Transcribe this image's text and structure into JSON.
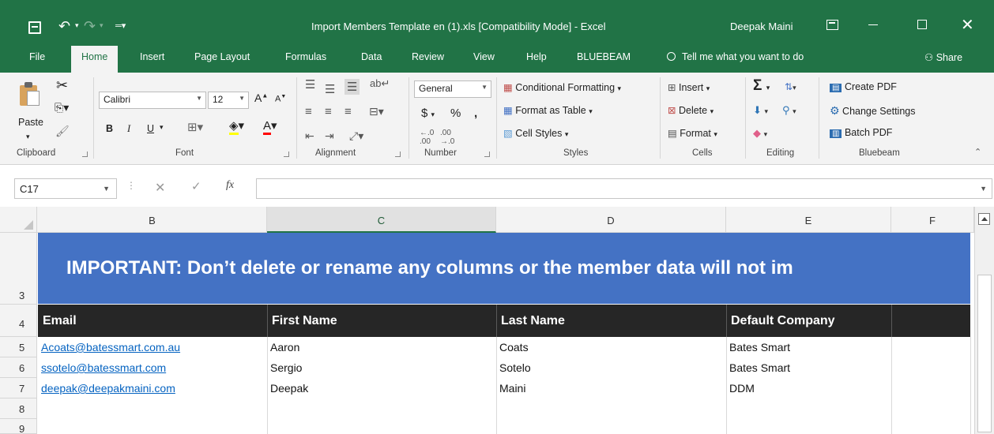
{
  "window": {
    "title": "Import Members Template en (1).xls  [Compatibility Mode]  -  Excel",
    "user": "Deepak Maini"
  },
  "tabs": [
    "File",
    "Home",
    "Insert",
    "Page Layout",
    "Formulas",
    "Data",
    "Review",
    "View",
    "Help",
    "BLUEBEAM"
  ],
  "active_tab": "Home",
  "tell_me": "Tell me what you want to do",
  "share": "Share",
  "ribbon": {
    "clipboard": {
      "paste": "Paste",
      "label": "Clipboard"
    },
    "font": {
      "name": "Calibri",
      "size": "12",
      "label": "Font",
      "bold": "B",
      "italic": "I",
      "underline": "U"
    },
    "alignment": {
      "label": "Alignment"
    },
    "number": {
      "format": "General",
      "currency": "$",
      "percent": "%",
      "comma": ",",
      "label": "Number"
    },
    "styles": {
      "conditional": "Conditional Formatting",
      "table": "Format as Table",
      "cell_styles": "Cell Styles",
      "label": "Styles"
    },
    "cells": {
      "insert": "Insert",
      "delete": "Delete",
      "format": "Format",
      "label": "Cells"
    },
    "editing": {
      "label": "Editing"
    },
    "bluebeam": {
      "create_pdf": "Create PDF",
      "change_settings": "Change Settings",
      "batch_pdf": "Batch PDF",
      "label": "Bluebeam"
    }
  },
  "formula_bar": {
    "name_box": "C17",
    "fx": "fx",
    "value": ""
  },
  "columns": [
    "B",
    "C",
    "D",
    "E",
    "F"
  ],
  "selected_column": "C",
  "rows": [
    "3",
    "4",
    "5",
    "6",
    "7",
    "8",
    "9"
  ],
  "banner": "IMPORTANT: Don’t delete or rename any columns or the member data will not im",
  "headers": [
    "Email",
    "First Name",
    "Last Name",
    "Default Company"
  ],
  "members": [
    {
      "email": "Acoats@batessmart.com.au",
      "first": "Aaron",
      "last": "Coats",
      "company": "Bates Smart"
    },
    {
      "email": "ssotelo@batessmart.com",
      "first": "Sergio",
      "last": "Sotelo",
      "company": "Bates Smart"
    },
    {
      "email": "deepak@deepakmaini.com",
      "first": "Deepak",
      "last": "Maini",
      "company": "DDM"
    }
  ],
  "colors": {
    "excel_green": "#217346",
    "banner_blue": "#4472c4",
    "header_dark": "#262626",
    "link": "#0563c1"
  }
}
